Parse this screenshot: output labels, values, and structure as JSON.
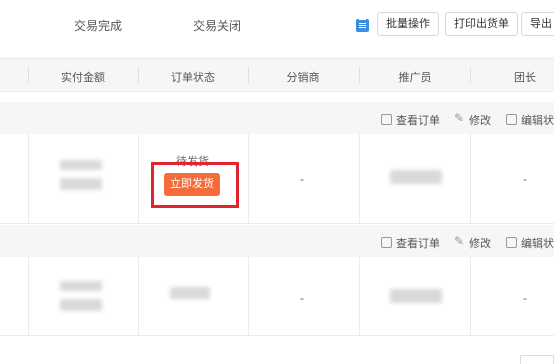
{
  "tabs": {
    "completed": "交易完成",
    "closed": "交易关闭"
  },
  "toolbar": {
    "batch_label": "批量操作",
    "print_label": "打印出货单",
    "export_label": "导出"
  },
  "table": {
    "columns": [
      "实付金额",
      "订单状态",
      "分销商",
      "推广员",
      "团长"
    ]
  },
  "group_actions": {
    "view_order": "查看订单",
    "edit": "修改",
    "edit_status": "编辑状"
  },
  "orders": [
    {
      "status": "待发货",
      "ship_label": "立即发货",
      "distributor": "-",
      "leader": "-"
    },
    {
      "status": "",
      "distributor": "-",
      "leader": "-"
    }
  ],
  "colors": {
    "accent": "#f56c3a",
    "highlight": "#e0262c",
    "batch_icon": "#3a8ee6"
  }
}
